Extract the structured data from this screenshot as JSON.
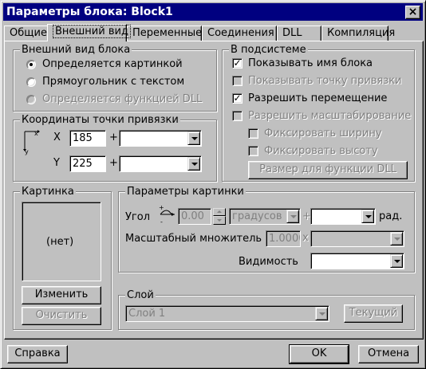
{
  "window": {
    "title": "Параметры блока: Block1",
    "close": "×"
  },
  "tabs": [
    {
      "label": "Общие"
    },
    {
      "label": "Внешний вид"
    },
    {
      "label": "Переменные"
    },
    {
      "label": "Соединения"
    },
    {
      "label": "DLL"
    },
    {
      "label": "Компиляция"
    }
  ],
  "appearance": {
    "title": "Внешний вид блока",
    "options": [
      {
        "label": "Определяется картинкой",
        "checked": true,
        "enabled": true
      },
      {
        "label": "Прямоугольник с текстом",
        "checked": false,
        "enabled": true
      },
      {
        "label": "Определяется функцией DLL",
        "checked": false,
        "enabled": false
      }
    ]
  },
  "anchor": {
    "title": "Координаты точки привязки",
    "axis_x": "x",
    "axis_y": "y",
    "x_label": "X",
    "x_value": "185",
    "x_plus": "+",
    "y_label": "Y",
    "y_value": "225",
    "y_plus": "+"
  },
  "subsystem": {
    "title": "В подсистеме",
    "items": [
      {
        "label": "Показывать имя блока",
        "checked": true,
        "enabled": true
      },
      {
        "label": "Показывать точку привязки",
        "checked": false,
        "enabled": false
      },
      {
        "label": "Разрешить перемещение",
        "checked": true,
        "enabled": true
      },
      {
        "label": "Разрешить масштабирование",
        "checked": false,
        "enabled": false
      },
      {
        "label": "Фиксировать ширину",
        "checked": false,
        "enabled": false
      },
      {
        "label": "Фиксировать высоту",
        "checked": false,
        "enabled": false
      }
    ],
    "dll_size_button": "Размер для функции DLL"
  },
  "picture": {
    "title": "Картинка",
    "empty": "(нет)",
    "change_button": "Изменить",
    "clear_button": "Очистить"
  },
  "picture_params": {
    "title": "Параметры картинки",
    "angle_label": "Угол",
    "angle_value": "0.00",
    "angle_unit": "градусов",
    "plus": "+",
    "rad_label": "рад.",
    "scale_label": "Масштабный множитель",
    "scale_value": "1.0000",
    "scale_x": "x",
    "visibility_label": "Видимость"
  },
  "layer": {
    "title": "Слой",
    "value": "Слой 1",
    "current_button": "Текущий"
  },
  "footer": {
    "help": "Справка",
    "ok": "OK",
    "cancel": "Отмена"
  }
}
